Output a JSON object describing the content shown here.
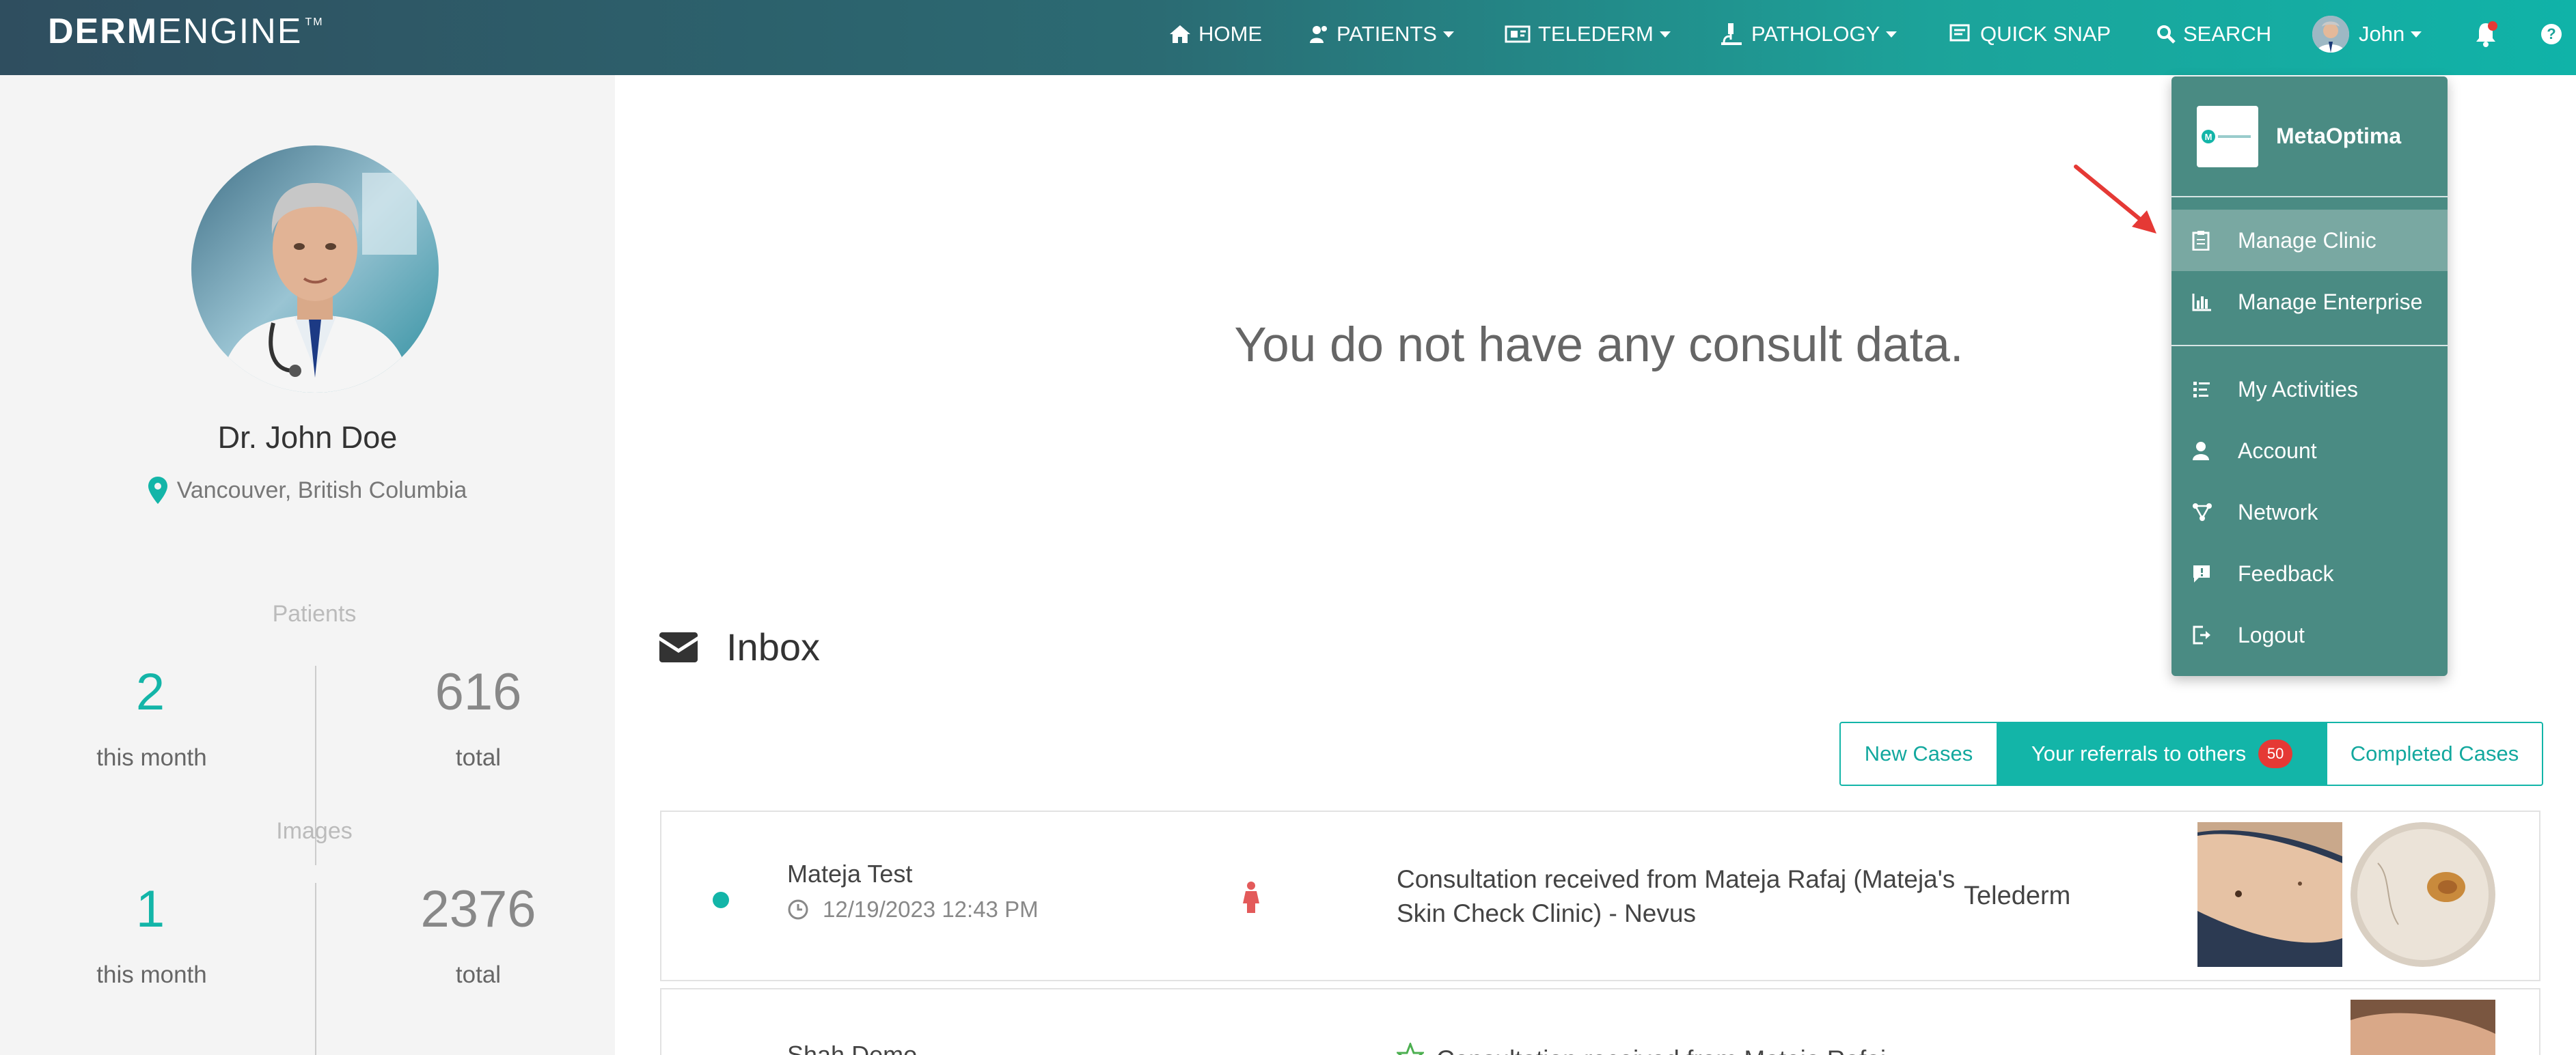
{
  "app": {
    "logo_bold": "DERM",
    "logo_light": "ENGINE",
    "logo_tm": "TM"
  },
  "nav": {
    "home": "HOME",
    "patients": "PATIENTS",
    "telederm": "TELEDERM",
    "pathology": "PATHOLOGY",
    "quick_snap": "QUICK SNAP",
    "search": "SEARCH",
    "user": "John"
  },
  "profile": {
    "name": "Dr. John Doe",
    "location": "Vancouver, British Columbia"
  },
  "stats": {
    "patients_heading": "Patients",
    "patients_month": "2",
    "patients_total": "616",
    "images_heading": "Images",
    "images_month": "1",
    "images_total": "2376",
    "this_month_label": "this month",
    "total_label": "total"
  },
  "main": {
    "empty_message": "You do not have any consult data.",
    "inbox_title": "Inbox"
  },
  "tabs": {
    "new_cases": "New Cases",
    "referrals": "Your referrals to others",
    "referrals_count": "50",
    "completed": "Completed Cases"
  },
  "cases": [
    {
      "name": "Mateja Test",
      "date": "12/19/2023 12:43 PM",
      "description": "Consultation received from Mateja Rafaj (Mateja's Skin Check Clinic) - Nevus",
      "type": "Telederm"
    },
    {
      "name": "Shah Demo",
      "description": "Consultation received from Mateja Rafaj"
    }
  ],
  "dropdown": {
    "org_name": "MetaOptima",
    "items": [
      {
        "label": "Manage Clinic",
        "icon": "clipboard-icon"
      },
      {
        "label": "Manage Enterprise",
        "icon": "bar-chart-icon"
      },
      {
        "label": "My Activities",
        "icon": "list-icon"
      },
      {
        "label": "Account",
        "icon": "user-icon"
      },
      {
        "label": "Network",
        "icon": "network-icon"
      },
      {
        "label": "Feedback",
        "icon": "feedback-icon"
      },
      {
        "label": "Logout",
        "icon": "logout-icon"
      }
    ]
  },
  "colors": {
    "accent": "#13b5a8",
    "dropdown_bg": "#4a8b83",
    "dropdown_highlight": "#79a8a2",
    "badge": "#e53935",
    "annotation_arrow": "#e53935"
  }
}
